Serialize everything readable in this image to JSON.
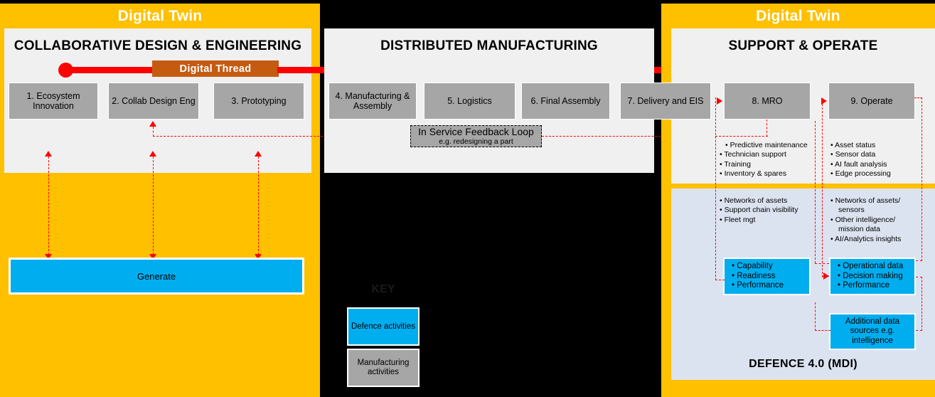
{
  "left": {
    "twin_title": "Digital Twin",
    "panel_title": "COLLABORATIVE DESIGN & ENGINEERING",
    "boxes": [
      {
        "label": "1. Ecosystem Innovation"
      },
      {
        "label": "2. Collab Design Eng"
      },
      {
        "label": "3. Prototyping"
      }
    ],
    "generate_label": "Generate"
  },
  "thread": {
    "chip_label": "Digital Thread"
  },
  "middle": {
    "panel_title": "DISTRIBUTED MANUFACTURING",
    "boxes": [
      {
        "label": "4. Manufacturing  & Assembly"
      },
      {
        "label": "5. Logistics"
      },
      {
        "label": "6. Final Assembly"
      },
      {
        "label": "7. Delivery and EIS"
      }
    ],
    "feedback": {
      "title": "In Service Feedback Loop",
      "subtitle": "e.g. redesigning a part"
    }
  },
  "right": {
    "twin_title": "Digital Twin",
    "panel_title": "SUPPORT & OPERATE",
    "boxes": [
      {
        "label": "8. MRO"
      },
      {
        "label": "9. Operate"
      }
    ],
    "mro_bullets": [
      "Predictive maintenance",
      "Technician support",
      "Training",
      "Inventory & spares"
    ],
    "operate_bullets": [
      "Asset status",
      "Sensor data",
      "AI fault analysis",
      "Edge processing"
    ]
  },
  "mdi": {
    "title": "DEFENCE 4.0  (MDI)",
    "left_bullets": [
      "Networks of assets",
      "Support chain visibility",
      "Fleet mgt"
    ],
    "right_bullets": [
      "Networks of assets/ sensors",
      "Other intelligence/ mission data",
      "AI/Analytics insights"
    ],
    "blue_left": [
      "Capability",
      "Readiness",
      "Performance"
    ],
    "blue_right": [
      "Operational data",
      "Decision making",
      "Performance"
    ],
    "blue_extra": "Additional data sources e.g. intelligence"
  },
  "key": {
    "title": "KEY",
    "items": [
      {
        "label": "Defence activities"
      },
      {
        "label": "Manufacturing activities"
      }
    ]
  },
  "colors": {
    "twin_yellow": "#FFC000",
    "panel_grey": "#F0F0F0",
    "process_grey": "#A6A6A6",
    "defence_blue": "#00AEEF",
    "mdi_blue": "#DCE3F0",
    "thread_red": "#FF0000",
    "thread_chip": "#C55A11"
  }
}
